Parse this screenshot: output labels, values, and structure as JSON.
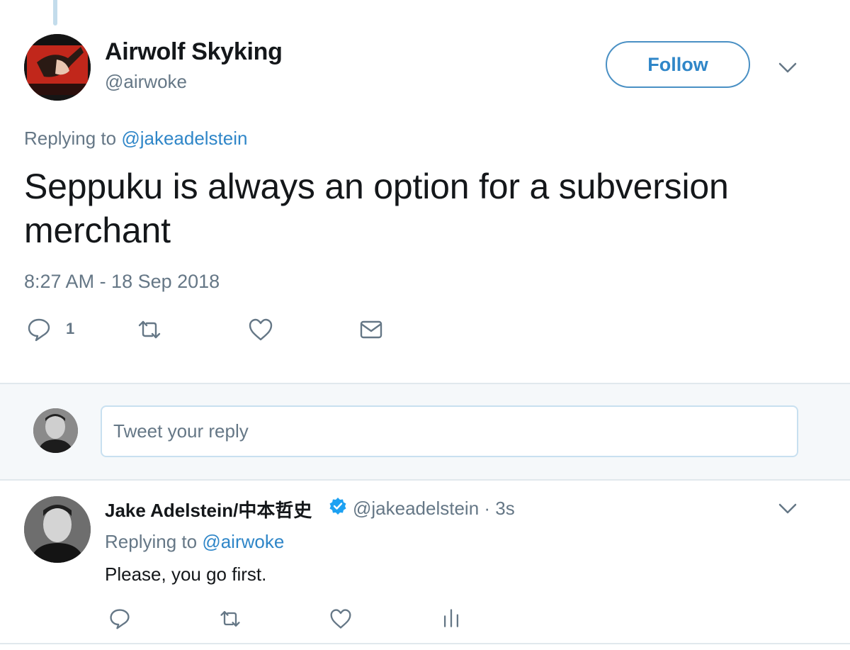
{
  "tweet": {
    "author_name": "Airwolf Skyking",
    "author_handle": "@airwoke",
    "follow_label": "Follow",
    "replying_prefix": "Replying to ",
    "replying_to": "@jakeadelstein",
    "text": "Seppuku is always an option for a subversion merchant",
    "timestamp": "8:27 AM - 18 Sep 2018",
    "reply_count": "1"
  },
  "compose": {
    "placeholder": "Tweet your reply"
  },
  "reply": {
    "author_name": "Jake Adelstein/中本哲史",
    "author_handle": "@jakeadelstein",
    "time": " · 3s",
    "replying_prefix": "Replying to ",
    "replying_to": "@airwoke",
    "text": "Please, you go first."
  },
  "colors": {
    "accent": "#2f86c8",
    "secondary_text": "#657786",
    "verified": "#1da1f2"
  },
  "icons": [
    "reply-icon",
    "retweet-icon",
    "like-icon",
    "direct-message-icon",
    "analytics-icon",
    "chevron-down-icon",
    "verified-badge-icon"
  ]
}
